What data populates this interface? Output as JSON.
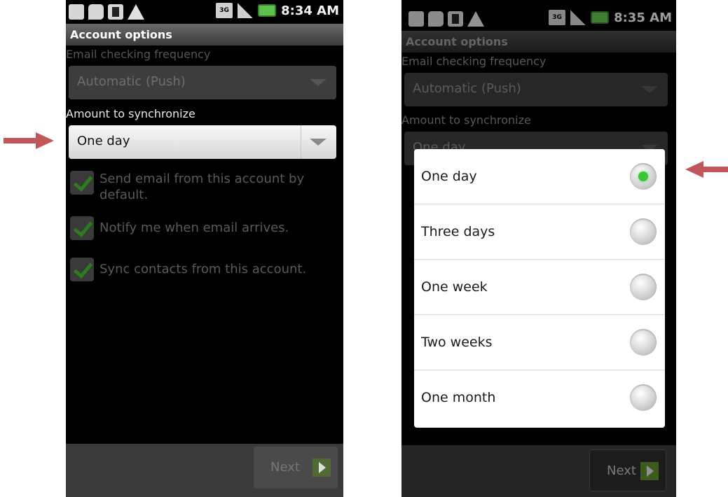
{
  "left_screen": {
    "status_time": "8:34 AM",
    "network_badge": "3G",
    "title": "Account options",
    "email_freq_label": "Email checking frequency",
    "email_freq_value": "Automatic (Push)",
    "sync_label": "Amount to synchronize",
    "sync_value": "One day",
    "checkboxes": [
      {
        "label": "Send email from this account by default.",
        "checked": true
      },
      {
        "label": "Notify me when email arrives.",
        "checked": true
      },
      {
        "label": "Sync contacts from this account.",
        "checked": true
      }
    ],
    "next_label": "Next"
  },
  "right_screen": {
    "status_time": "8:35 AM",
    "network_badge": "3G",
    "title": "Account options",
    "email_freq_label": "Email checking frequency",
    "email_freq_value": "Automatic (Push)",
    "sync_label": "Amount to synchronize",
    "sync_value_partial": "One day",
    "options": [
      {
        "label": "One day",
        "selected": true
      },
      {
        "label": "Three days",
        "selected": false
      },
      {
        "label": "One week",
        "selected": false
      },
      {
        "label": "Two weeks",
        "selected": false
      },
      {
        "label": "One month",
        "selected": false
      }
    ],
    "next_label": "Next"
  },
  "colors": {
    "callout_arrow": "#c25558",
    "selected_radio": "#3cc43a",
    "checkmark": "#2e7a1e"
  },
  "icons": [
    "keyboard-icon",
    "message-icon",
    "usb-icon",
    "warning-icon",
    "network-3g-icon",
    "signal-icon",
    "battery-icon"
  ]
}
